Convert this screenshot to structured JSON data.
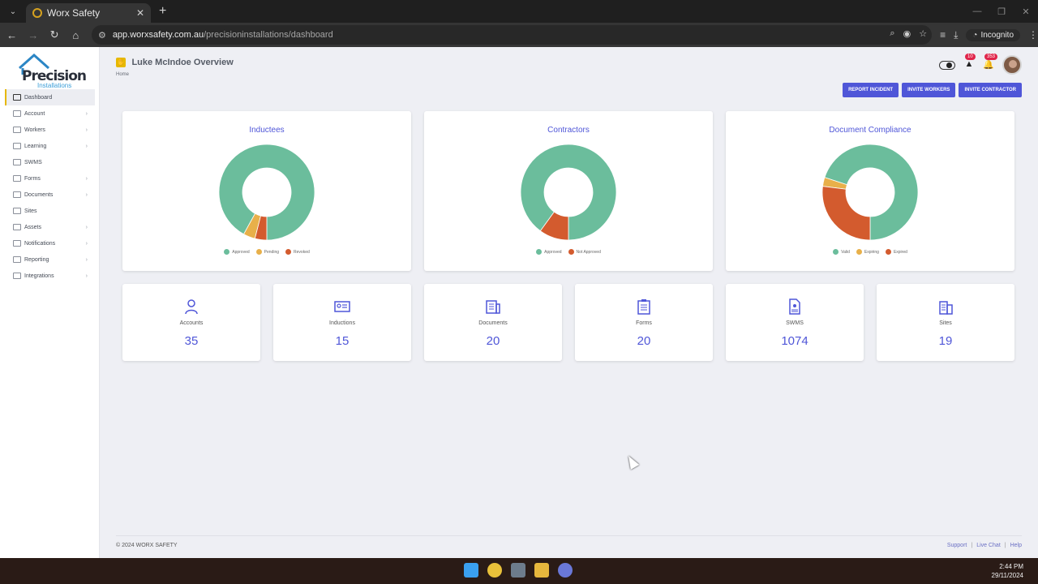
{
  "browser": {
    "tab_title": "Worx Safety",
    "tab_close": "✕",
    "new_tab": "+",
    "url_host": "app.worxsafety.com.au",
    "url_path": "/precisioninstallations/dashboard",
    "incognito_label": "Incognito"
  },
  "sidebar": {
    "logo_text": "Precision",
    "logo_sub": "Installations",
    "items": [
      {
        "label": "Dashboard",
        "active": true,
        "chevron": false
      },
      {
        "label": "Account",
        "chevron": true
      },
      {
        "label": "Workers",
        "chevron": true
      },
      {
        "label": "Learning",
        "chevron": true
      },
      {
        "label": "SWMS",
        "chevron": false
      },
      {
        "label": "Forms",
        "chevron": true
      },
      {
        "label": "Documents",
        "chevron": true
      },
      {
        "label": "Sites",
        "chevron": false
      },
      {
        "label": "Assets",
        "chevron": true
      },
      {
        "label": "Notifications",
        "chevron": true
      },
      {
        "label": "Reporting",
        "chevron": true
      },
      {
        "label": "Integrations",
        "chevron": true
      }
    ]
  },
  "header": {
    "title": "Luke McIndoe Overview",
    "breadcrumb": "Home",
    "alerts_count": "10",
    "notifications_count": "353"
  },
  "actions": {
    "report_incident": "REPORT INCIDENT",
    "invite_workers": "INVITE WORKERS",
    "invite_contractor": "INVITE CONTRACTOR"
  },
  "colors": {
    "green": "#6bbd9c",
    "yellow": "#e8b04a",
    "orange": "#d35b2e",
    "accent": "#4f56d8"
  },
  "charts": {
    "inductees": {
      "title": "Inductees",
      "legend": [
        "Approved",
        "Pending",
        "Revoked"
      ]
    },
    "contractors": {
      "title": "Contractors",
      "legend": [
        "Approved",
        "Not Approved"
      ]
    },
    "compliance": {
      "title": "Document Compliance",
      "legend": [
        "Valid",
        "Expiring",
        "Expired"
      ]
    }
  },
  "chart_data": [
    {
      "type": "pie",
      "title": "Inductees",
      "categories": [
        "Approved",
        "Pending",
        "Revoked"
      ],
      "values": [
        92,
        4,
        4
      ]
    },
    {
      "type": "pie",
      "title": "Contractors",
      "categories": [
        "Approved",
        "Not Approved"
      ],
      "values": [
        90,
        10
      ]
    },
    {
      "type": "pie",
      "title": "Document Compliance",
      "categories": [
        "Valid",
        "Expiring",
        "Expired"
      ],
      "values": [
        70,
        3,
        27
      ]
    }
  ],
  "stats": [
    {
      "label": "Accounts",
      "value": "35",
      "icon": "user-icon"
    },
    {
      "label": "Inductions",
      "value": "15",
      "icon": "id-card-icon"
    },
    {
      "label": "Documents",
      "value": "20",
      "icon": "documents-icon"
    },
    {
      "label": "Forms",
      "value": "20",
      "icon": "clipboard-icon"
    },
    {
      "label": "SWMS",
      "value": "1074",
      "icon": "swms-file-icon"
    },
    {
      "label": "Sites",
      "value": "19",
      "icon": "building-icon"
    }
  ],
  "footer": {
    "copyright": "© 2024 WORX SAFETY",
    "support": "Support",
    "live_chat": "Live Chat",
    "help": "Help",
    "separator": "|"
  },
  "taskbar": {
    "time": "2:44 PM",
    "date": "29/11/2024"
  }
}
